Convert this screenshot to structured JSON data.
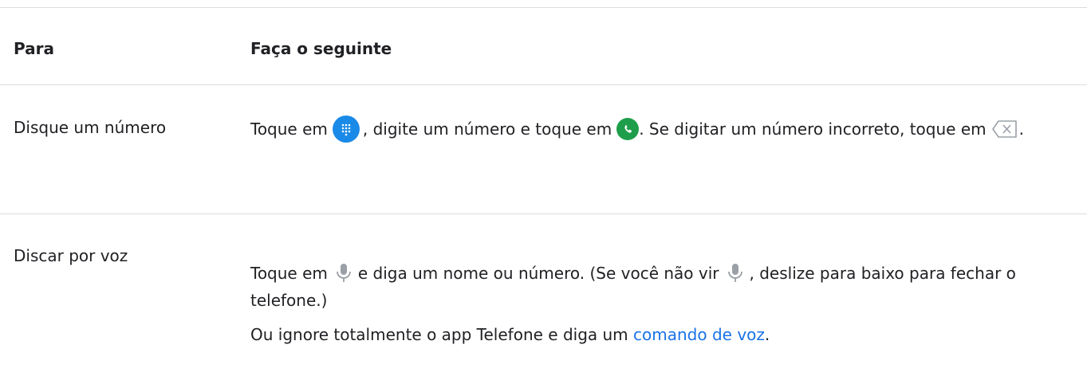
{
  "table": {
    "headers": [
      "Para",
      "Faça o seguinte"
    ],
    "rows": [
      {
        "action": "Disque um número",
        "parts": {
          "t1": "Toque em",
          "t2": ", digite um número e toque em",
          "t3": ". Se digitar um número incorreto, toque em",
          "t4": "."
        }
      },
      {
        "action": "Discar por voz",
        "parts": {
          "t1": "Toque em",
          "t2": "e diga um nome ou número. (Se você não vir",
          "t3": ", deslize para baixo para fechar o telefone.)",
          "t4": "Ou ignore totalmente o app Telefone e diga um",
          "link": "comando de voz",
          "t5": "."
        }
      }
    ]
  },
  "icons": {
    "dialpad": "dialpad-icon",
    "call": "call-icon",
    "backspace": "backspace-icon",
    "mic": "mic-icon"
  },
  "colors": {
    "divider": "#dadce0",
    "link": "#1a73e8",
    "dialpad_bg": "#1a8ae8",
    "call_bg": "#1e9e4a",
    "icon_gray": "#9aa0a6"
  }
}
